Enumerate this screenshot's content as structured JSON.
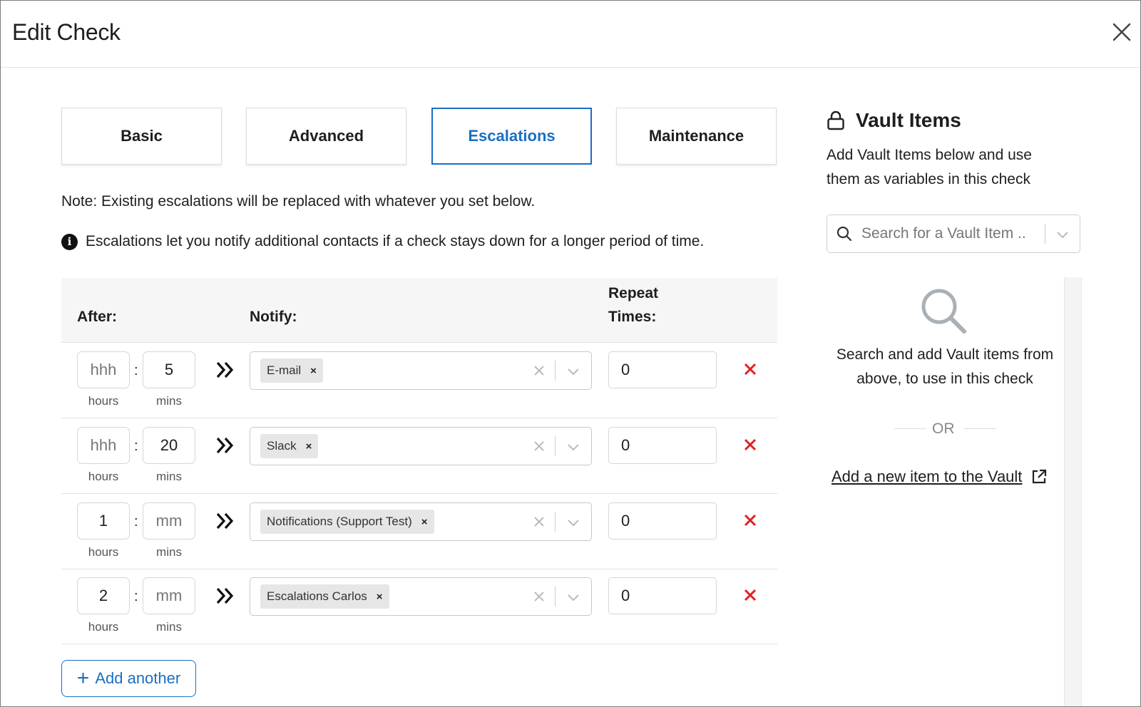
{
  "dialog": {
    "title": "Edit Check"
  },
  "tabs": [
    {
      "label": "Basic",
      "active": false
    },
    {
      "label": "Advanced",
      "active": false
    },
    {
      "label": "Escalations",
      "active": true
    },
    {
      "label": "Maintenance",
      "active": false
    }
  ],
  "note": "Note: Existing escalations will be replaced with whatever you set below.",
  "info": "Escalations let you notify additional contacts if a check stays down for a longer period of time.",
  "table": {
    "headers": {
      "after": "After:",
      "notify": "Notify:",
      "repeat_line1": "Repeat",
      "repeat_line2": "Times:"
    },
    "hours_label": "hours",
    "mins_label": "mins",
    "colon": ":",
    "rows": [
      {
        "hours": "",
        "hours_placeholder": "hhh",
        "mins": "5",
        "mins_placeholder": "mm",
        "notify": "E-mail",
        "repeat": "0"
      },
      {
        "hours": "",
        "hours_placeholder": "hhh",
        "mins": "20",
        "mins_placeholder": "mm",
        "notify": "Slack",
        "repeat": "0"
      },
      {
        "hours": "1",
        "hours_placeholder": "hhh",
        "mins": "",
        "mins_placeholder": "mm",
        "notify": "Notifications (Support Test)",
        "repeat": "0"
      },
      {
        "hours": "2",
        "hours_placeholder": "hhh",
        "mins": "",
        "mins_placeholder": "mm",
        "notify": "Escalations Carlos",
        "repeat": "0"
      }
    ],
    "chip_remove": "×"
  },
  "add_button": {
    "icon": "+",
    "label": "Add another"
  },
  "vault": {
    "title": "Vault Items",
    "description": "Add Vault Items below and use them as variables in this check",
    "search_placeholder": "Search for a Vault Item ..",
    "empty_message": "Search and add Vault items from above, to use in this check",
    "or_label": "OR",
    "add_link": "Add a new item to the Vault"
  },
  "colors": {
    "accent": "#1a6fc4",
    "danger": "#e02020",
    "header_bg": "#f6f6f6"
  }
}
